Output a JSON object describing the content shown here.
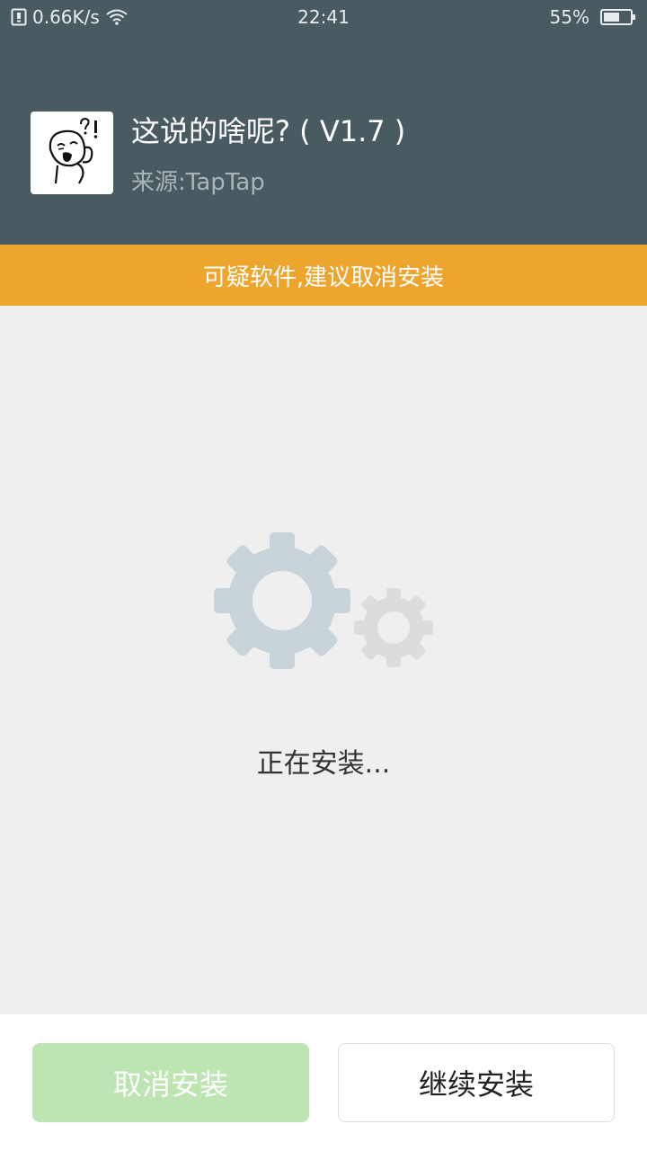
{
  "status_bar": {
    "net_speed": "0.66K/s",
    "time": "22:41",
    "battery_percent": "55%"
  },
  "app": {
    "title": "这说的啥呢? ( V1.7 )",
    "source": "来源:TapTap",
    "icon": "cartoon-face-icon"
  },
  "warning": {
    "text": "可疑软件,建议取消安装",
    "color": "#eea52e"
  },
  "progress": {
    "status_text": "正在安装..."
  },
  "buttons": {
    "cancel_label": "取消安装",
    "continue_label": "继续安装"
  },
  "colors": {
    "header_bg": "#4a5a61",
    "cancel_button": "#bde5b1"
  }
}
